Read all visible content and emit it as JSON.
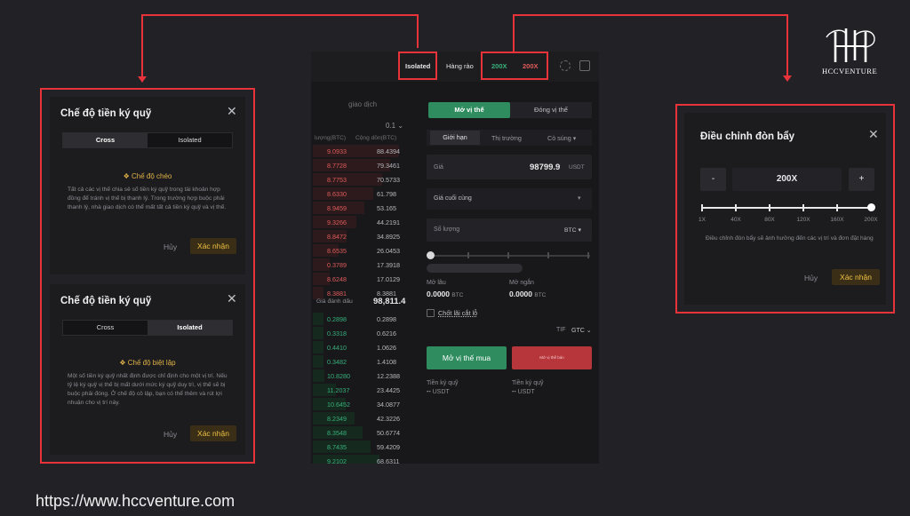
{
  "top_bar": {
    "isolated": "Isolated",
    "hedge": "Hàng rào",
    "lev_long": "200X",
    "lev_short": "200X"
  },
  "orderbook": {
    "title": "giao dịch",
    "precision": "0.1",
    "col_amount": "lượng(BTC)",
    "col_total": "Cộng dồn(BTC)",
    "asks": [
      {
        "amount": "9.0933",
        "total": "88.4394"
      },
      {
        "amount": "8.7728",
        "total": "79.3461"
      },
      {
        "amount": "8.7753",
        "total": "70.5733"
      },
      {
        "amount": "8.6330",
        "total": "61.798"
      },
      {
        "amount": "8.9459",
        "total": "53.165"
      },
      {
        "amount": "9.3266",
        "total": "44.2191"
      },
      {
        "amount": "8.8472",
        "total": "34.8925"
      },
      {
        "amount": "8.6535",
        "total": "26.0453"
      },
      {
        "amount": "0.3789",
        "total": "17.3918"
      },
      {
        "amount": "8.6248",
        "total": "17.0129"
      },
      {
        "amount": "8.3881",
        "total": "8.3881"
      }
    ],
    "mark_label": "Giá đánh dấu",
    "mark_price": "98,811.4",
    "bids": [
      {
        "amount": "0.2898",
        "total": "0.2898"
      },
      {
        "amount": "0.3318",
        "total": "0.6216"
      },
      {
        "amount": "0.4410",
        "total": "1.0626"
      },
      {
        "amount": "0.3482",
        "total": "1.4108"
      },
      {
        "amount": "10.8280",
        "total": "12.2388"
      },
      {
        "amount": "11.2037",
        "total": "23.4425"
      },
      {
        "amount": "10.6452",
        "total": "34.0877"
      },
      {
        "amount": "8.2349",
        "total": "42.3226"
      },
      {
        "amount": "8.3548",
        "total": "50.6774"
      },
      {
        "amount": "8.7435",
        "total": "59.4209"
      },
      {
        "amount": "9.2102",
        "total": "68.6311"
      }
    ]
  },
  "order_form": {
    "tab_open": "Mở vị thế",
    "tab_close": "Đóng vị thế",
    "type_limit": "Giới hạn",
    "type_market": "Thị trường",
    "type_trigger": "Cò súng",
    "price_label": "Giá",
    "price_value": "98799.9",
    "price_unit": "USDT",
    "last_price": "Giá cuối cùng",
    "qty_label": "Số lượng",
    "qty_unit": "BTC",
    "open_long_label": "Mở lâu",
    "open_long_value": "0.0000",
    "open_long_unit": "BTC",
    "open_short_label": "Mở ngắn",
    "open_short_value": "0.0000",
    "open_short_unit": "BTC",
    "tp_sl": "Chốt lãi cắt lỗ",
    "tif": "TIF",
    "gtc": "GTC",
    "buy_btn": "Mở vị thế mua",
    "sell_btn": "Mở vị thế bán",
    "margin_label_1": "Tiền ký quỹ",
    "margin_value_1": "--",
    "margin_unit_1": "USDT",
    "margin_label_2": "Tiền ký quỹ",
    "margin_value_2": "--",
    "margin_unit_2": "USDT"
  },
  "margin_dialog_cross": {
    "title": "Chế độ tiền ký quỹ",
    "opt_cross": "Cross",
    "opt_isolated": "Isolated",
    "mode_title": "Chế độ chéo",
    "desc": "Tất cả các vị thế chia sẻ số tiền ký quỹ trong tài khoản hợp đồng để tránh vị thế bị thanh lý. Trong trường hợp buộc phải thanh lý, nhà giao dịch có thể mất tất cả tiền ký quỹ và vị thế.",
    "cancel": "Hủy",
    "confirm": "Xác nhận"
  },
  "margin_dialog_isolated": {
    "title": "Chế độ tiền ký quỹ",
    "opt_cross": "Cross",
    "opt_isolated": "Isolated",
    "mode_title": "Chế độ biệt lập",
    "desc": "Một số tiền ký quỹ nhất định được chỉ định cho một vị trí. Nếu tỷ lệ ký quỹ vị thế bị mất dưới mức ký quỹ duy trì, vị thế sẽ bị buộc phải đóng. Ở chế độ cô lập, bạn có thể thêm và rút lợi nhuận cho vị trí này.",
    "cancel": "Hủy",
    "confirm": "Xác nhận"
  },
  "leverage_dialog": {
    "title": "Điều chỉnh đòn bẩy",
    "minus": "-",
    "value": "200X",
    "plus": "+",
    "slider_level": 1.0,
    "ticks": [
      "1X",
      "40X",
      "80X",
      "120X",
      "160X",
      "200X"
    ],
    "note": "Điều chỉnh đòn bẩy sẽ ảnh hưởng đến các vị trí và đơn đặt hàng",
    "cancel": "Hủy",
    "confirm": "Xác nhận"
  },
  "brand": {
    "name": "HCCVENTURE"
  },
  "url": "https://www.hccventure.com",
  "colors": {
    "annotation": "#e8333a",
    "buy": "#2e8c5f",
    "sell": "#b6363b",
    "accent": "#f0c043"
  }
}
